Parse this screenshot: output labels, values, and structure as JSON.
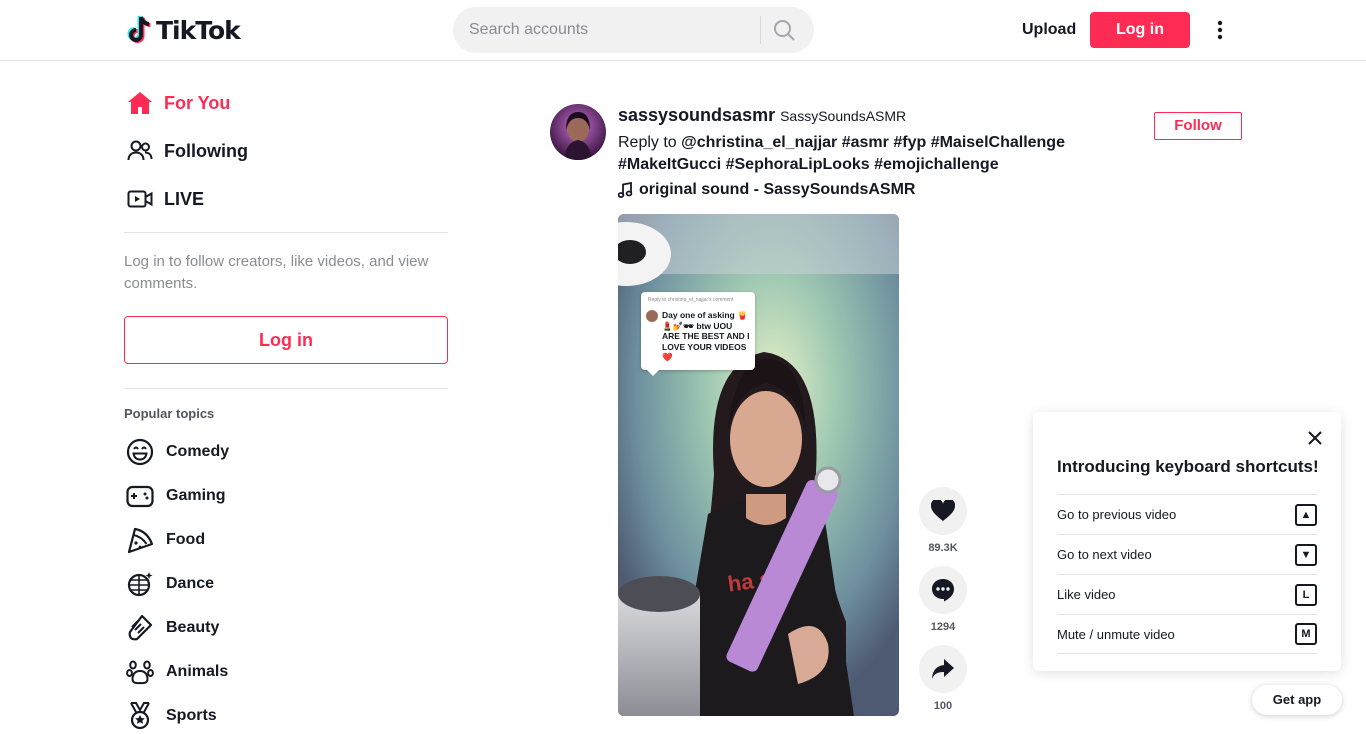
{
  "header": {
    "logo_text": "TikTok",
    "search_placeholder": "Search accounts",
    "upload_label": "Upload",
    "login_label": "Log in",
    "brand_color": "#fe2c55"
  },
  "sidebar": {
    "nav": [
      {
        "label": "For You",
        "icon": "home-icon",
        "active": true
      },
      {
        "label": "Following",
        "icon": "people-icon",
        "active": false
      },
      {
        "label": "LIVE",
        "icon": "live-icon",
        "active": false
      }
    ],
    "login_prompt": "Log in to follow creators, like videos, and view comments.",
    "login_label": "Log in",
    "topics_title": "Popular topics",
    "topics": [
      {
        "label": "Comedy",
        "icon": "smile-icon"
      },
      {
        "label": "Gaming",
        "icon": "gamepad-icon"
      },
      {
        "label": "Food",
        "icon": "pizza-icon"
      },
      {
        "label": "Dance",
        "icon": "disco-ball-icon"
      },
      {
        "label": "Beauty",
        "icon": "comb-icon"
      },
      {
        "label": "Animals",
        "icon": "paw-icon"
      },
      {
        "label": "Sports",
        "icon": "medal-icon"
      }
    ]
  },
  "post": {
    "username": "sassysoundsasmr",
    "nickname": "SassySoundsASMR",
    "caption_prefix": "Reply to",
    "caption_tags": [
      "@christina_el_najjar",
      "#asmr",
      "#fyp",
      "#MaiselChallenge",
      "#MakeItGucci",
      "#SephoraLipLooks",
      "#emojichallenge"
    ],
    "music": "original sound - SassySoundsASMR",
    "follow_label": "Follow",
    "sticker_reply": "Reply to christina_el_najjar's comment",
    "sticker_text": "Day one of asking 🍟💄💅🕶 btw UOU ARE THE BEST AND I LOVE YOUR VIDEOS ❤️",
    "actions": [
      {
        "name": "like",
        "icon": "heart-icon",
        "count": "89.3K"
      },
      {
        "name": "comment",
        "icon": "comment-icon",
        "count": "1294"
      },
      {
        "name": "share",
        "icon": "share-icon",
        "count": "100"
      }
    ]
  },
  "shortcuts": {
    "title": "Introducing keyboard shortcuts!",
    "items": [
      {
        "label": "Go to previous video",
        "key": "▲"
      },
      {
        "label": "Go to next video",
        "key": "▼"
      },
      {
        "label": "Like video",
        "key": "L"
      },
      {
        "label": "Mute / unmute video",
        "key": "M"
      }
    ]
  },
  "get_app_label": "Get app"
}
